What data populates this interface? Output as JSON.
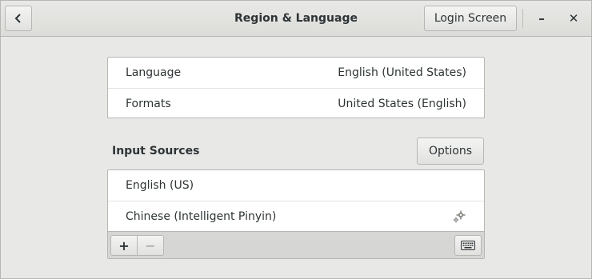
{
  "header": {
    "title": "Region & Language",
    "login_screen_label": "Login Screen",
    "back_icon": "chevron-left-icon",
    "minimize_glyph": "–",
    "close_glyph": "✕"
  },
  "language_settings": {
    "rows": [
      {
        "label": "Language",
        "value": "English (United States)"
      },
      {
        "label": "Formats",
        "value": "United States (English)"
      }
    ]
  },
  "input_sources": {
    "title": "Input Sources",
    "options_label": "Options",
    "items": [
      {
        "label": "English (US)"
      },
      {
        "label": "Chinese (Intelligent Pinyin)",
        "has_settings": true
      }
    ],
    "toolbar": {
      "add_glyph": "+",
      "remove_glyph": "−"
    }
  }
}
